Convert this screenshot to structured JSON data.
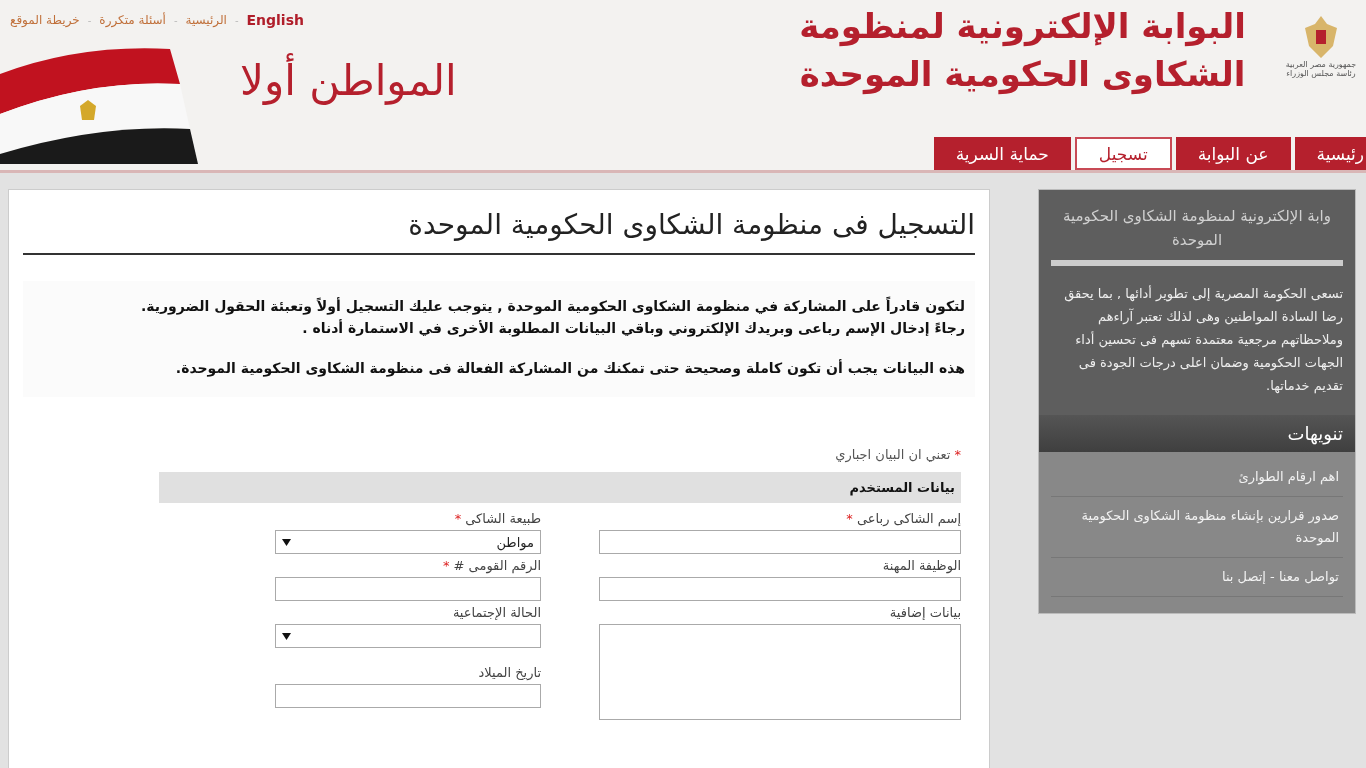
{
  "top_link_separator": "-",
  "top_links": [
    {
      "label": "English",
      "selected": true
    },
    {
      "label": "الرئيسية",
      "selected": false
    },
    {
      "label": "أسئلة متكررة",
      "selected": false
    },
    {
      "label": "خريطة الموقع",
      "selected": false
    }
  ],
  "header": {
    "slogan": "المواطن أولا",
    "title_lines": [
      "البوابة الإلكترونية لمنظومة",
      "الشكاوى الحكومية الموحدة"
    ],
    "emblem_lines": [
      "جمهورية مصر العربية",
      "رئاسة مجلس الوزراء"
    ]
  },
  "nav_tabs": [
    {
      "label": "رئيسية",
      "selected": false
    },
    {
      "label": "عن البوابة",
      "selected": false
    },
    {
      "label": "تسجيل",
      "selected": true
    },
    {
      "label": "حماية السرية",
      "selected": false
    }
  ],
  "page_title": "التسجيل فى منظومة الشكاوى الحكومية الموحدة",
  "intro": [
    "لتكون قادراً على المشاركة في منظومة الشكاوى الحكومية الموحدة , يتوجب عليك التسجيل أولاً وتعبئة الحقول الضرورية.",
    "رجاءً إدخال الإسم رباعى وبريدك الإلكتروني وباقي البيانات المطلوبة الأخرى في الاستمارة أدناه .",
    "هذه البيانات يجب أن تكون كاملة وصحيحة حتى تمكنك من المشاركة الفعالة فى منظومة الشكاوى الحكومية الموحدة."
  ],
  "required_note": {
    "mark": "*",
    "text": "تعني ان البيان اجباري"
  },
  "section_title": "بيانات المستخدم",
  "fields": [
    {
      "kind": "text",
      "label": "إسم الشاكى رباعى",
      "mark": "*"
    },
    {
      "kind": "select",
      "label": "طبيعة الشاكى",
      "mark": "*",
      "value": "مواطن"
    },
    {
      "kind": "text",
      "label": "الوظيفة المهنة"
    },
    {
      "kind": "text",
      "label": "الرقم القومى #",
      "mark": "*"
    },
    {
      "kind": "textarea",
      "label": "بيانات إضافية"
    },
    {
      "kind": "select",
      "label": "الحالة الإجتماعية"
    },
    {
      "kind": "text",
      "label": "تاريخ الميلاد"
    }
  ],
  "sidebar": {
    "title": "وابة الإلكترونية لمنظومة الشكاوى الحكومية الموحدة",
    "text": "تسعى الحكومة المصرية إلى تطوير أدائها , بما يحقق رضا السادة المواطنين وهى لذلك تعتبر آراءهم وملاحظاتهم مرجعية معتمدة تسهم فى تحسين أداء الجهات الحكومية وضمان اعلى درجات الجودة فى تقديم خدماتها.",
    "notices_title": "تنويهات",
    "notices": [
      "اهم ارقام الطوارئ",
      "صدور قرارين بإنشاء منظومة الشكاوى الحكومية الموحدة",
      "تواصل معنا - إتصل بنا"
    ]
  }
}
